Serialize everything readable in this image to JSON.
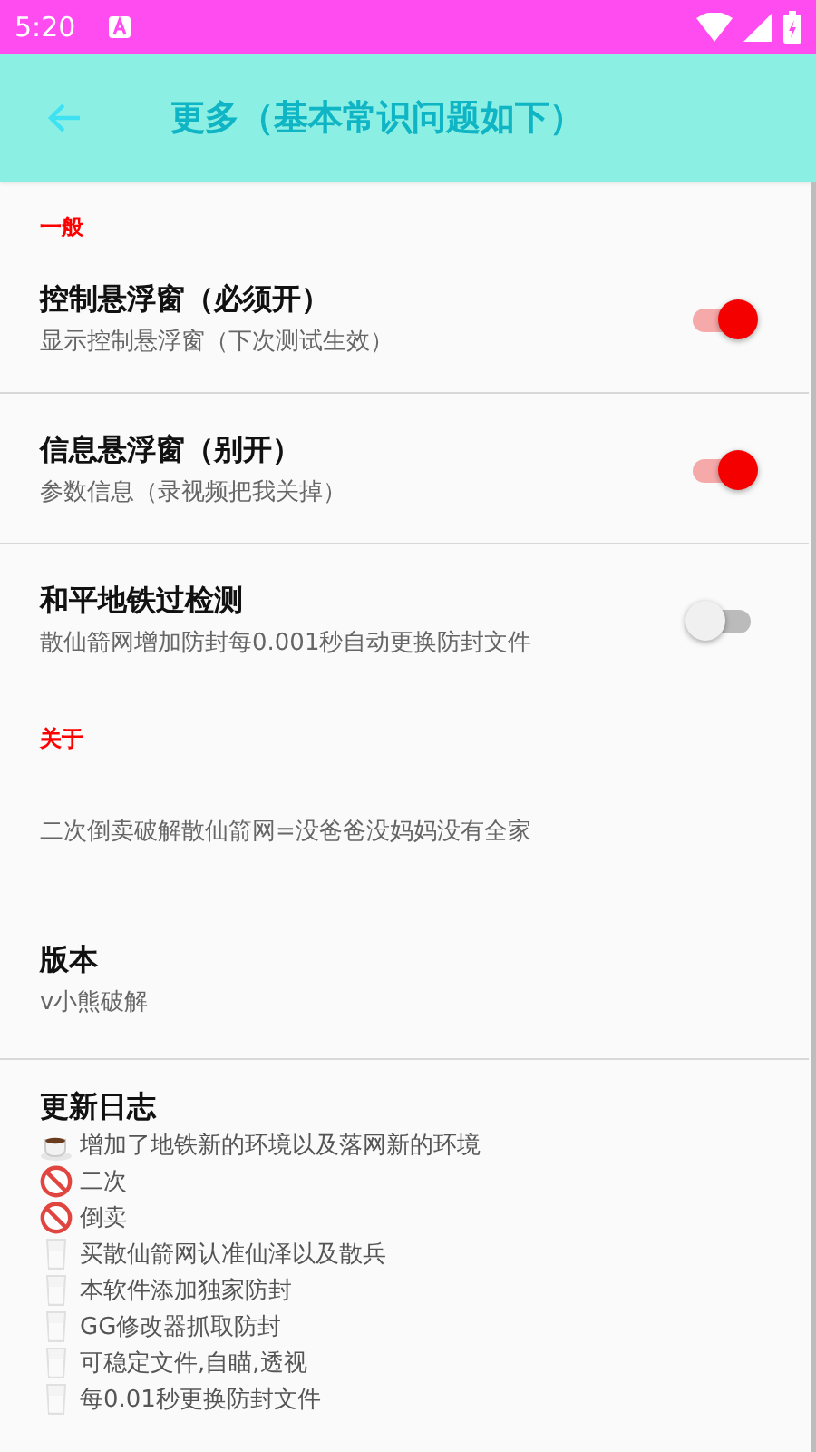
{
  "status_bar": {
    "time": "5:20"
  },
  "app_bar": {
    "title": "更多（基本常识问题如下）"
  },
  "sections": [
    {
      "header": "一般",
      "items": [
        {
          "kind": "switch",
          "title": "控制悬浮窗（必须开）",
          "summary": "显示控制悬浮窗（下次测试生效）",
          "on": true
        },
        {
          "kind": "switch",
          "title": "信息悬浮窗（别开）",
          "summary": "参数信息（录视频把我关掉）",
          "on": true
        },
        {
          "kind": "switch",
          "title": "和平地铁过检测",
          "summary": "散仙箭网增加防封每0.001秒自动更换防封文件",
          "on": false
        }
      ]
    },
    {
      "header": "关于",
      "items": [
        {
          "kind": "text",
          "summary": "二次倒卖破解散仙箭网=没爸爸没妈妈没有全家"
        },
        {
          "kind": "info",
          "title": "版本",
          "summary": "v小熊破解"
        },
        {
          "kind": "log",
          "title": "更新日志",
          "lines": [
            {
              "kind": "cup",
              "text": "增加了地铁新的环境以及落网新的环境"
            },
            {
              "kind": "ban",
              "text": "二次"
            },
            {
              "kind": "ban",
              "text": "倒卖"
            },
            {
              "kind": "glass",
              "text": "买散仙箭网认准仙泽以及散兵"
            },
            {
              "kind": "glass",
              "text": "本软件添加独家防封"
            },
            {
              "kind": "glass",
              "text": "GG修改器抓取防封"
            },
            {
              "kind": "glass",
              "text": "可稳定文件,自瞄,透视"
            },
            {
              "kind": "glass",
              "text": "每0.01秒更换防封文件"
            }
          ]
        }
      ]
    }
  ]
}
